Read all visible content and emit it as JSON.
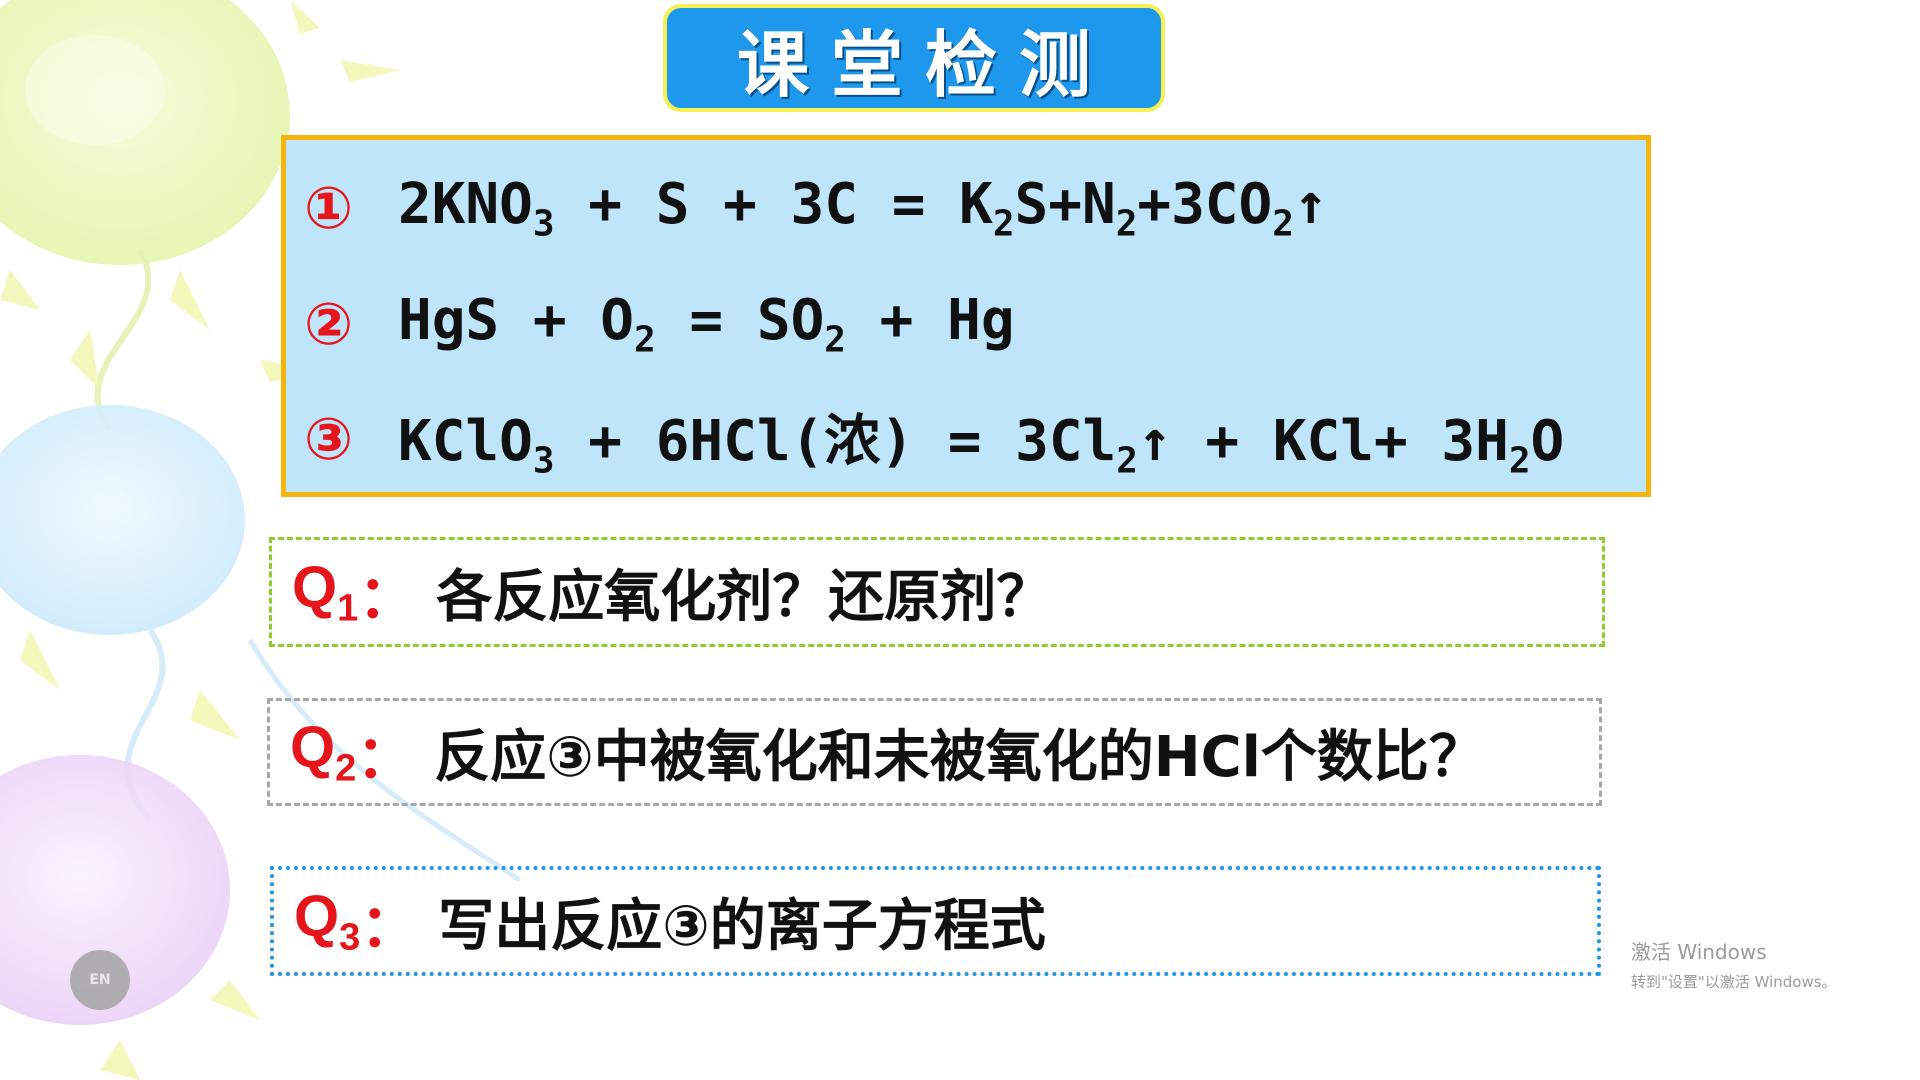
{
  "title": "课堂检测",
  "equations": [
    {
      "num": "①",
      "parts": [
        [
          "2KNO",
          ""
        ],
        [
          "3",
          "sub"
        ],
        [
          " + S + 3C = K",
          ""
        ],
        [
          "2",
          "sub"
        ],
        [
          "S+N",
          ""
        ],
        [
          "2",
          "sub"
        ],
        [
          "+3CO",
          ""
        ],
        [
          "2",
          "sub"
        ],
        [
          "↑",
          ""
        ]
      ]
    },
    {
      "num": "②",
      "parts": [
        [
          "HgS + O",
          ""
        ],
        [
          "2",
          "sub"
        ],
        [
          " = SO",
          ""
        ],
        [
          "2",
          "sub"
        ],
        [
          "  + Hg",
          ""
        ]
      ]
    },
    {
      "num": "③",
      "parts": [
        [
          "KClO",
          ""
        ],
        [
          "3",
          "sub"
        ],
        [
          " + 6HCl(浓) = 3Cl",
          ""
        ],
        [
          "2",
          "sub"
        ],
        [
          "↑ + KCl+ 3H",
          ""
        ],
        [
          "2",
          "sub"
        ],
        [
          "O",
          ""
        ]
      ]
    }
  ],
  "questions": [
    {
      "label": "Q",
      "sub": "1",
      "colon": "：",
      "text": "各反应氧化剂？还原剂？"
    },
    {
      "label": "Q",
      "sub": "2",
      "colon": "：",
      "text": "反应③中被氧化和未被氧化的HCl个数比？"
    },
    {
      "label": "Q",
      "sub": "3",
      "colon": "：",
      "text": "写出反应③的离子方程式"
    }
  ],
  "watermark": {
    "line1": "激活 Windows",
    "line2": "转到\"设置\"以激活 Windows。"
  },
  "input_indicator": {
    "label": "EN",
    "icon": "keyboard-language-icon"
  },
  "colors": {
    "title_bg": "#1e98ec",
    "title_border": "#f5f055",
    "eq_bg": "#bfe5fb",
    "eq_border": "#f6b40c",
    "accent_red": "#e6141b",
    "q1_border": "#8ccf2b",
    "q2_border": "#a8a8a8",
    "q3_border": "#1a96e8"
  }
}
